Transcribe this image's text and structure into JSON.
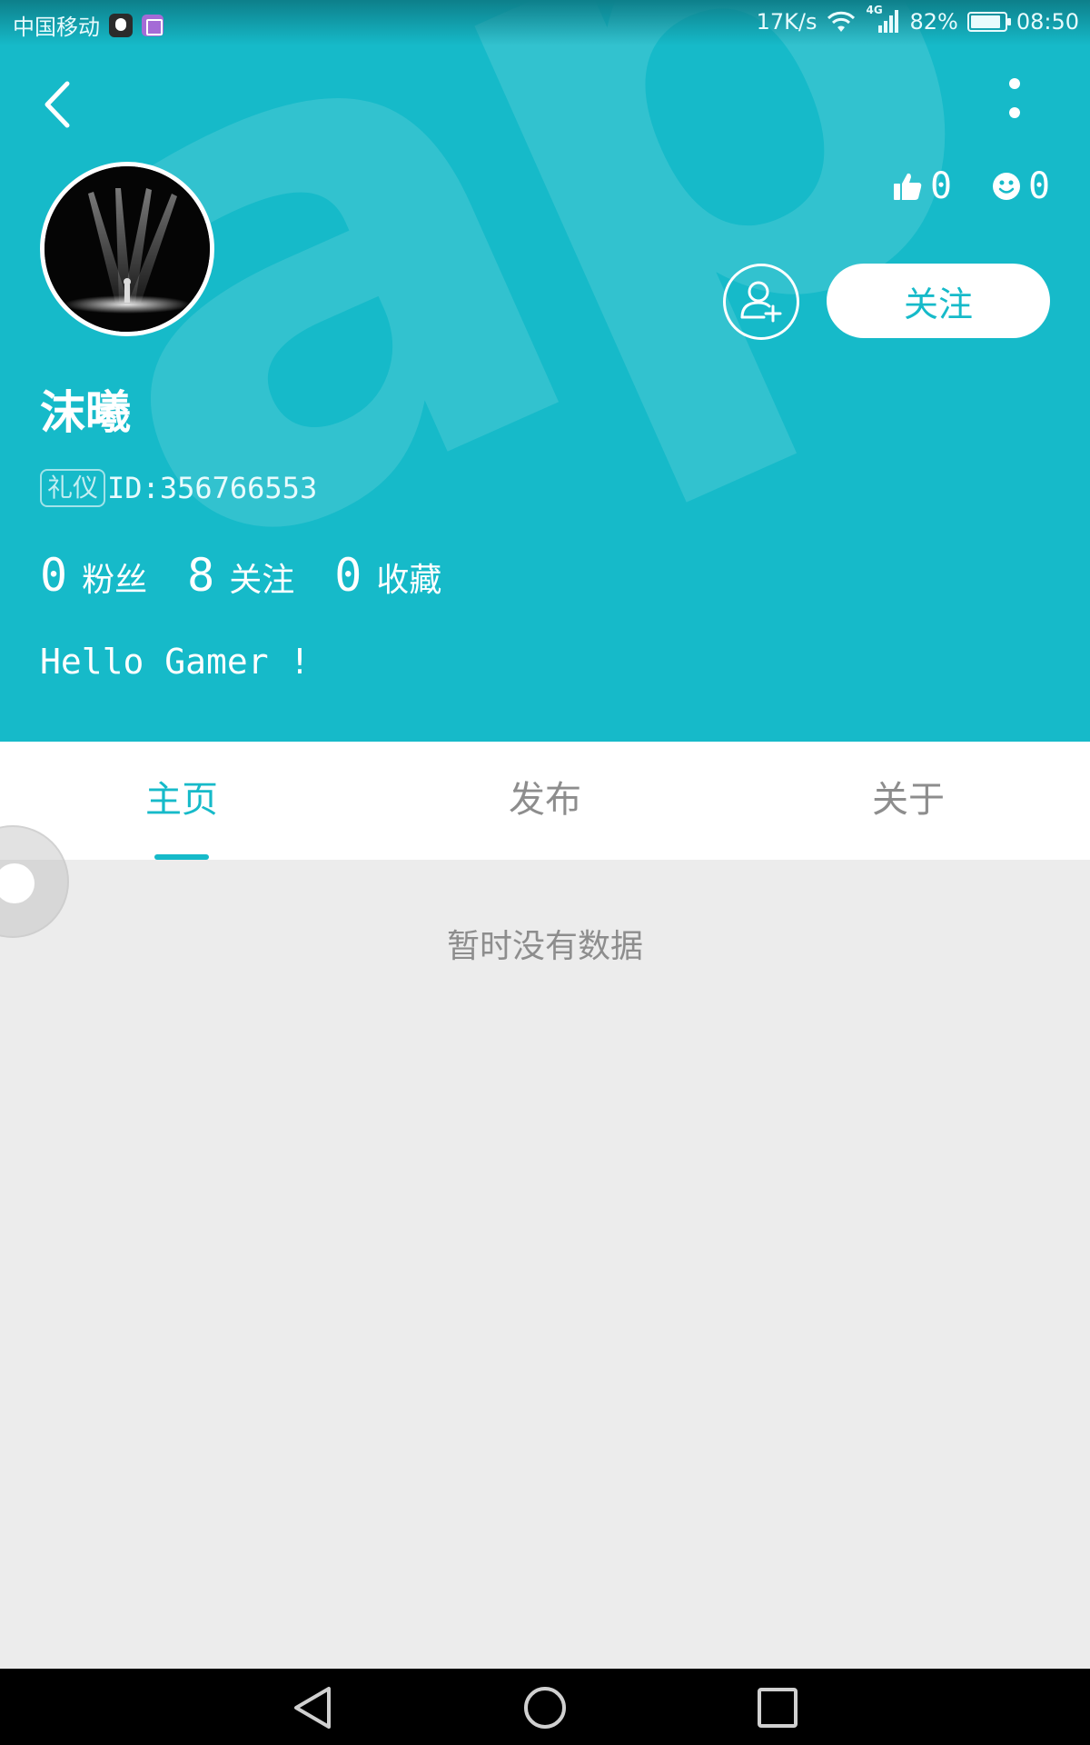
{
  "status_bar": {
    "carrier": "中国移动",
    "speed": "17K/s",
    "network": "4G",
    "battery": "82%",
    "time": "08:50"
  },
  "profile": {
    "username": "沫曦",
    "badge": "礼仪",
    "id": "ID:356766553",
    "bio": "Hello Gamer !",
    "likes": "0",
    "smiles": "0",
    "follow_label": "关注",
    "stats": [
      {
        "num": "0",
        "label": "粉丝"
      },
      {
        "num": "8",
        "label": "关注"
      },
      {
        "num": "0",
        "label": "收藏"
      }
    ]
  },
  "tabs": [
    {
      "label": "主页",
      "active": true
    },
    {
      "label": "发布",
      "active": false
    },
    {
      "label": "关于",
      "active": false
    }
  ],
  "content": {
    "empty_text": "暂时没有数据"
  },
  "colors": {
    "accent": "#16bac9",
    "background": "#ececec",
    "muted_text": "#8d8d8d"
  },
  "icons": [
    "back-icon",
    "more-icon",
    "thumbs-up-icon",
    "smile-icon",
    "add-friend-icon",
    "nav-back-icon",
    "nav-home-icon",
    "nav-recent-icon"
  ]
}
